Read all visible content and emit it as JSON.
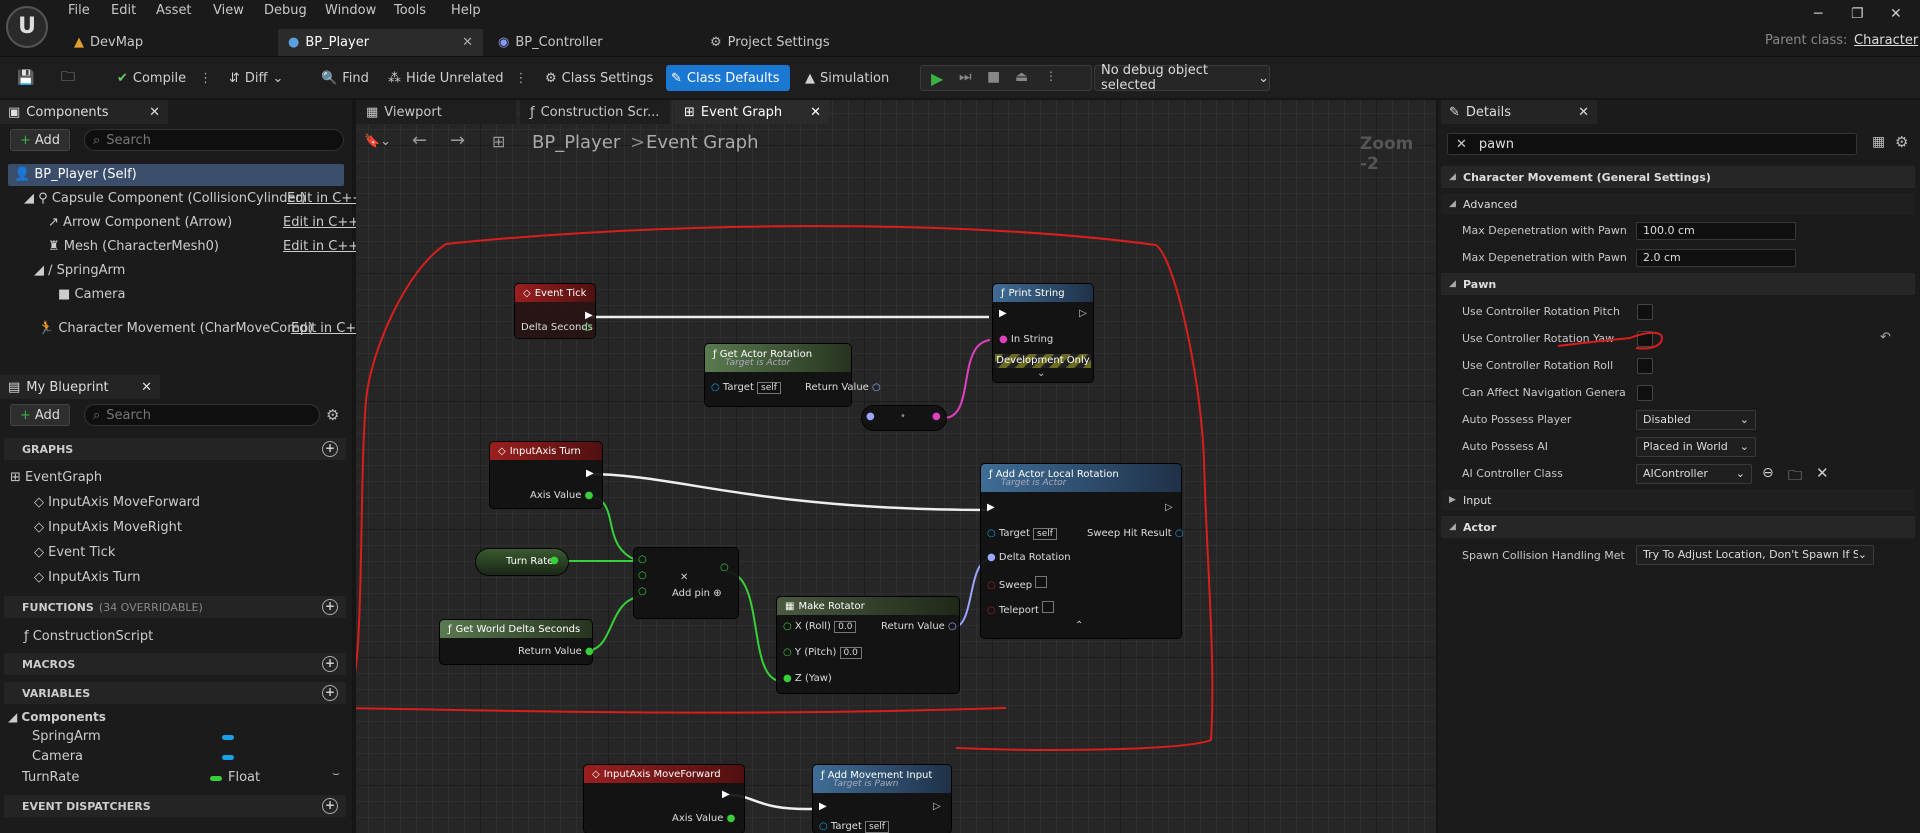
{
  "menu": [
    "File",
    "Edit",
    "Asset",
    "View",
    "Debug",
    "Window",
    "Tools",
    "Help"
  ],
  "tabs": [
    "DevMap",
    "BP_Player",
    "BP_Controller",
    "Project Settings"
  ],
  "parent_class": {
    "label": "Parent class:",
    "value": "Character"
  },
  "toolbar": {
    "compile": "Compile",
    "diff": "Diff",
    "find": "Find",
    "hide_unrelated": "Hide Unrelated",
    "class_settings": "Class Settings",
    "class_defaults": "Class Defaults",
    "simulation": "Simulation",
    "debug_object": "No debug object selected"
  },
  "components": {
    "title": "Components",
    "add": "Add",
    "search_placeholder": "Search",
    "items": [
      "BP_Player (Self)",
      "Capsule Component (CollisionCylinder)",
      "Arrow Component (Arrow)",
      "Mesh (CharacterMesh0)",
      "SpringArm",
      "Camera",
      "Character Movement (CharMoveComp)"
    ],
    "edit_cpp": "Edit in C++",
    "edit_cpp_cut": "Edit in C+"
  },
  "my_blueprint": {
    "title": "My Blueprint",
    "add": "Add",
    "search_placeholder": "Search",
    "graphs_header": "GRAPHS",
    "event_graph": "EventGraph",
    "graph_items": [
      "InputAxis MoveForward",
      "InputAxis MoveRight",
      "Event Tick",
      "InputAxis Turn"
    ],
    "functions_header": "FUNCTIONS",
    "functions_overridable": "(34 OVERRIDABLE)",
    "construction": "ConstructionScript",
    "macros_header": "MACROS",
    "variables_header": "VARIABLES",
    "components_cat": "Components",
    "vars": [
      "SpringArm",
      "Camera"
    ],
    "turnrate": {
      "name": "TurnRate",
      "type": "Float"
    },
    "dispatchers_header": "EVENT DISPATCHERS"
  },
  "graph": {
    "tabs": [
      "Viewport",
      "Construction Scr...",
      "Event Graph"
    ],
    "breadcrumb_root": "BP_Player",
    "breadcrumb_sep": ">",
    "breadcrumb_leaf": "Event Graph",
    "zoom": "Zoom -2",
    "nodes": {
      "event_tick": {
        "title": "Event Tick",
        "pin": "Delta Seconds"
      },
      "print_string": {
        "title": "Print String",
        "pin": "In String",
        "dev": "Development Only"
      },
      "get_actor_rotation": {
        "title": "Get Actor Rotation",
        "sub": "Target is Actor",
        "target": "Target",
        "self": "self",
        "ret": "Return Value"
      },
      "inputaxis_turn": {
        "title": "InputAxis Turn",
        "pin": "Axis Value"
      },
      "add_actor_local_rotation": {
        "title": "Add Actor Local Rotation",
        "sub": "Target is Actor",
        "target": "Target",
        "self": "self",
        "sweep_hit": "Sweep Hit Result",
        "delta": "Delta Rotation",
        "sweep": "Sweep",
        "teleport": "Teleport"
      },
      "turn_rate": {
        "title": "Turn Rate"
      },
      "multiply": {
        "add_pin": "Add pin"
      },
      "get_world_delta": {
        "title": "Get World Delta Seconds",
        "ret": "Return Value"
      },
      "make_rotator": {
        "title": "Make Rotator",
        "x": "X (Roll)",
        "y": "Y (Pitch)",
        "z": "Z (Yaw)",
        "xv": "0.0",
        "yv": "0.0",
        "ret": "Return Value"
      },
      "inputaxis_moveforward": {
        "title": "InputAxis MoveForward",
        "pin": "Axis Value"
      },
      "add_movement_input": {
        "title": "Add Movement Input",
        "sub": "Target is Pawn",
        "target": "Target",
        "self": "self"
      }
    }
  },
  "details": {
    "title": "Details",
    "search_value": "pawn",
    "section_cm": "Character Movement (General Settings)",
    "advanced": "Advanced",
    "max_dep_pawn": {
      "label": "Max Depenetration with Pawn",
      "value": "100.0 cm"
    },
    "max_dep_pawn2": {
      "label": "Max Depenetration with Pawn...",
      "value": "2.0 cm"
    },
    "section_pawn": "Pawn",
    "use_pitch": {
      "label": "Use Controller Rotation Pitch",
      "checked": false
    },
    "use_yaw": {
      "label": "Use Controller Rotation Yaw",
      "checked": false
    },
    "use_roll": {
      "label": "Use Controller Rotation Roll",
      "checked": false
    },
    "can_affect_nav": {
      "label": "Can Affect Navigation Generat...",
      "checked": false
    },
    "auto_possess_player": {
      "label": "Auto Possess Player",
      "value": "Disabled"
    },
    "auto_possess_ai": {
      "label": "Auto Possess AI",
      "value": "Placed in World"
    },
    "ai_controller": {
      "label": "AI Controller Class",
      "value": "AIController"
    },
    "section_input": "Input",
    "section_actor": "Actor",
    "spawn_collision": {
      "label": "Spawn Collision Handling Met...",
      "value": "Try To Adjust Location, Don't Spawn If St"
    }
  },
  "colors": {
    "accent": "#1a77d2",
    "annotation": "#d91e1e",
    "event_header": "#8b1a1a",
    "function_header": "#3d5f7a",
    "pure_header": "#4a6a40"
  }
}
